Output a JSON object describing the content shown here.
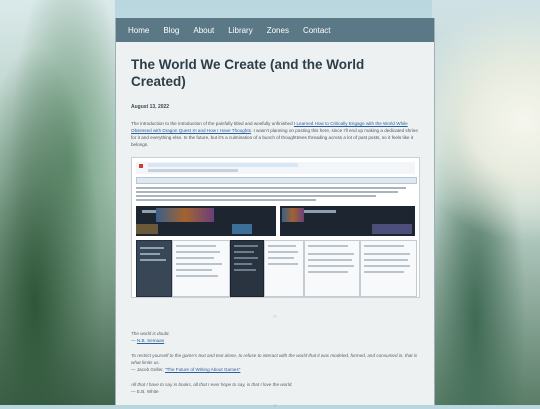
{
  "nav": {
    "items": [
      "Home",
      "Blog",
      "About",
      "Library",
      "Zones",
      "Contact"
    ]
  },
  "post": {
    "title": "The World We Create (and the World Created)",
    "date": "August 13, 2022",
    "intro_start": "The introduction to the introduction of the painfully titled and woefully unfinished ",
    "intro_link": "I Learned How to Critically Engage with the World While Obsessed with Dragon Quest XI and How I Have Thoughts",
    "intro_end": ". I wasn't planning on posting this here, since I'll end up making a dedicated shrine for it and everything else. In the future, but it's a culmination of a bunch of thoughttrees threading across a lot of past posts, so it feels like it belongs.",
    "image_caption_mark": "⁙"
  },
  "quotes": [
    {
      "text": "The world is doubt.",
      "attribution_prefix": "— ",
      "attribution_link": "N.B. Semaan",
      "attribution_suffix": ""
    },
    {
      "text": "To restrict yourself to the game's text and text alone, to refuse to interact with the world that it was modeled, formed, and consumed in, that is what limits us.",
      "attribution_prefix": "— Jacob Geller, ",
      "attribution_link": "\"The Future of Writing About Games\"",
      "attribution_suffix": ""
    },
    {
      "text": "All that I have to say in books, all that I ever hope to say, is that I love the world.",
      "attribution_prefix": "— E.B. White",
      "attribution_link": "",
      "attribution_suffix": ""
    }
  ],
  "bottom_mark": "⁙",
  "colors": {
    "nav_bg": "#5a7885",
    "title": "#2c3e48",
    "link": "#2b5f9e"
  }
}
